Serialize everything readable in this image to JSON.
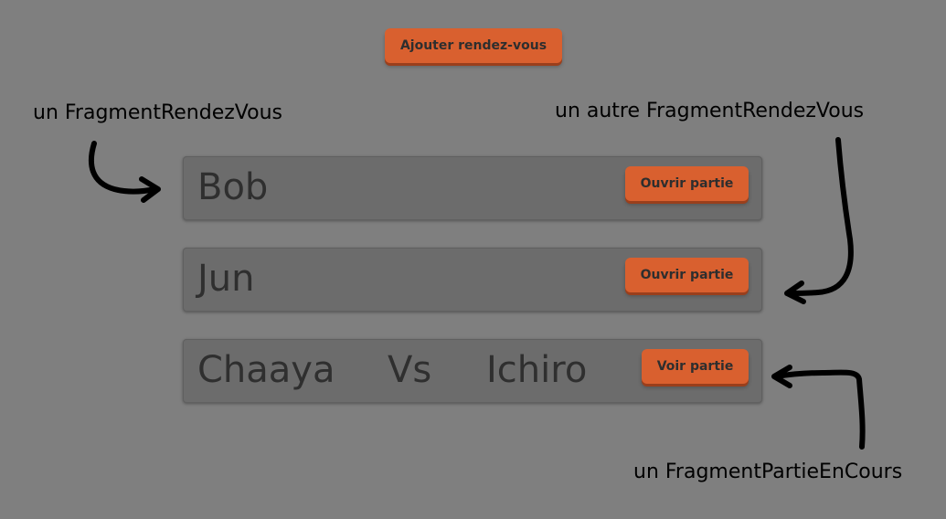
{
  "header": {
    "add_button_label": "Ajouter rendez-vous"
  },
  "cards": [
    {
      "name": "Bob",
      "button_label": "Ouvrir partie"
    },
    {
      "name": "Jun",
      "button_label": "Ouvrir partie"
    },
    {
      "player1": "Chaaya",
      "vs": "Vs",
      "player2": "Ichiro",
      "button_label": "Voir partie"
    }
  ],
  "annotations": {
    "left_top": "un FragmentRendezVous",
    "right_top": "un autre FragmentRendezVous",
    "right_bottom": "un FragmentPartieEnCours"
  },
  "colors": {
    "background": "#7f7f7f",
    "card": "#6c6c6c",
    "button": "#d9602f"
  }
}
